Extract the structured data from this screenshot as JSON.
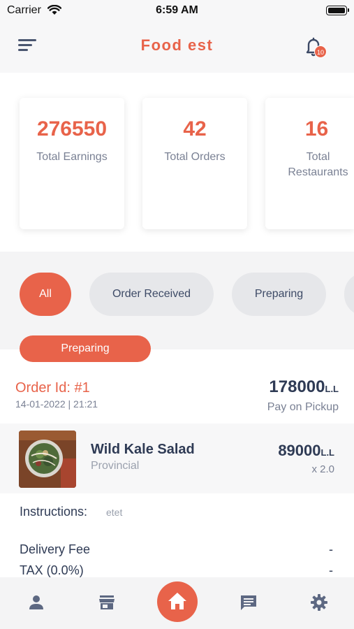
{
  "status_bar": {
    "carrier": "Carrier",
    "time": "6:59 AM"
  },
  "header": {
    "title": "Food est",
    "notification_count": "10"
  },
  "stats": [
    {
      "value": "276550",
      "label": "Total Earnings"
    },
    {
      "value": "42",
      "label": "Total Orders"
    },
    {
      "value": "16",
      "label": "Total Restaurants"
    }
  ],
  "filters": [
    "All",
    "Order Received",
    "Preparing"
  ],
  "order": {
    "status": "Preparing",
    "id": "Order Id: #1",
    "datetime": "14-01-2022 | 21:21",
    "total": "178000",
    "currency": "L.L",
    "payment": "Pay on Pickup",
    "item": {
      "name": "Wild Kale Salad",
      "restaurant": "Provincial",
      "price": "89000",
      "qty": "x 2.0"
    },
    "instructions_label": "Instructions:",
    "instructions": "etet",
    "delivery_fee_label": "Delivery Fee",
    "delivery_fee": "-",
    "tax_label": "TAX (0.0%)",
    "tax": "-"
  },
  "colors": {
    "accent": "#e8634a",
    "text": "#2f3b55",
    "muted": "#7a8194"
  },
  "tabbar": [
    "person-icon",
    "store-icon",
    "home-icon",
    "chat-icon",
    "gear-icon"
  ]
}
